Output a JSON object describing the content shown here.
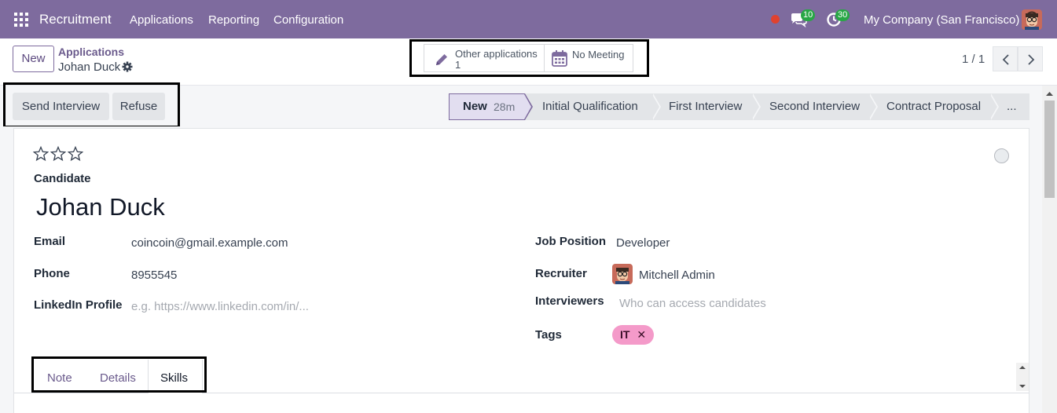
{
  "navbar": {
    "brand": "Recruitment",
    "menu": [
      "Applications",
      "Reporting",
      "Configuration"
    ],
    "messages_count": "10",
    "activities_count": "30",
    "company": "My Company (San Francisco)"
  },
  "control_panel": {
    "new_label": "New",
    "breadcrumb_parent": "Applications",
    "breadcrumb_current": "Johan Duck",
    "smart_buttons": {
      "other_applications_label": "Other applications",
      "other_applications_count": "1",
      "meeting_label": "No Meeting"
    },
    "pager": "1 / 1"
  },
  "actions": {
    "send_interview": "Send Interview",
    "refuse": "Refuse"
  },
  "stages": {
    "current": "New",
    "current_duration": "28m",
    "items": [
      "Initial Qualification",
      "First Interview",
      "Second Interview",
      "Contract Proposal",
      "..."
    ]
  },
  "form": {
    "priority_stars": 0,
    "candidate_label": "Candidate",
    "candidate_name": "Johan Duck",
    "email_label": "Email",
    "email_value": "coincoin@gmail.example.com",
    "phone_label": "Phone",
    "phone_value": "8955545",
    "linkedin_label": "LinkedIn Profile",
    "linkedin_placeholder": "e.g. https://www.linkedin.com/in/...",
    "job_position_label": "Job Position",
    "job_position_value": "Developer",
    "recruiter_label": "Recruiter",
    "recruiter_value": "Mitchell Admin",
    "interviewers_label": "Interviewers",
    "interviewers_placeholder": "Who can access candidates",
    "tags_label": "Tags",
    "tags": [
      "IT"
    ]
  },
  "tabs": {
    "items": [
      "Note",
      "Details",
      "Skills"
    ],
    "active": "Skills"
  },
  "colors": {
    "navbar": "#7e6b9e",
    "accent": "#7e6b9e",
    "tag_it": "#f49ac9",
    "badge": "#28a745"
  }
}
